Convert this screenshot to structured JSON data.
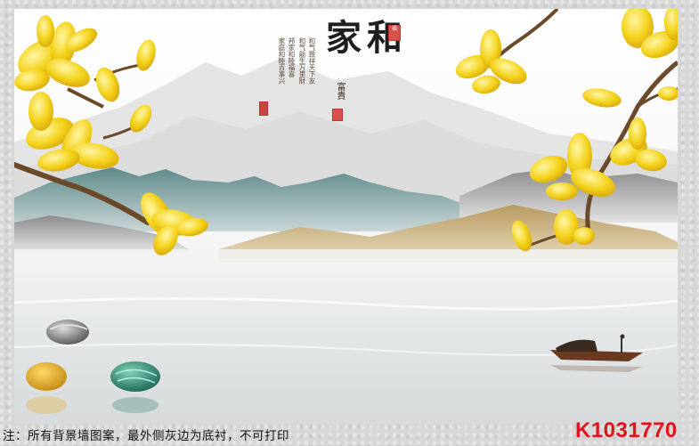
{
  "artwork": {
    "title": "家和",
    "subtitle": "富貴",
    "seal_top": "福",
    "poem_lines": [
      "和气致祥天下友",
      "和气能生万里財",
      "邦家和睦福喜",
      "家庭和睦百事兴"
    ]
  },
  "footer": {
    "note": "注：所有背景墙图案，最外侧灰边为底衬，不可打印",
    "product_code": "K1031770"
  },
  "colors": {
    "frame": "#d7d7d7",
    "flower": "#f3d21a",
    "branch": "#6b4a2a",
    "mountain_teal": "#7e9c9c",
    "mountain_gold": "#c7ad7a",
    "code_red": "#e0141b"
  }
}
